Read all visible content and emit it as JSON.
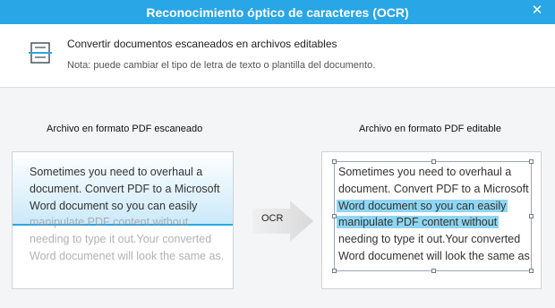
{
  "window": {
    "title": "Reconocimiento óptico de caracteres (OCR)",
    "close_glyph": "✕"
  },
  "header": {
    "icon": "scanner-document-icon",
    "title": "Convertir documentos escaneados en archivos editables",
    "note": "Nota: puede cambiar el tipo de letra de texto o plantilla del documento."
  },
  "left_panel": {
    "label": "Archivo en formato PDF escaneado",
    "lines": [
      "Sometimes you need to overhaul a",
      "document. Convert PDF to a Microsoft",
      "Word document so you can easily",
      "manipulate PDF content without",
      "needing to type it out.Your converted",
      "Word documenet will look the same as."
    ]
  },
  "arrow": {
    "label": "OCR",
    "icon": "right-arrow-icon"
  },
  "right_panel": {
    "label": "Archivo en formato PDF editable",
    "lines": [
      "Sometimes you need to overhaul a",
      "document. Convert PDF to a Microsoft",
      "Word document so you can easily",
      "manipulate PDF content without",
      "needing to type it out.Your converted",
      "Word documenet will look the same as."
    ]
  },
  "colors": {
    "accent": "#29a6e6",
    "highlight": "#8fd6f2",
    "scan_line": "#2aa7e8"
  }
}
